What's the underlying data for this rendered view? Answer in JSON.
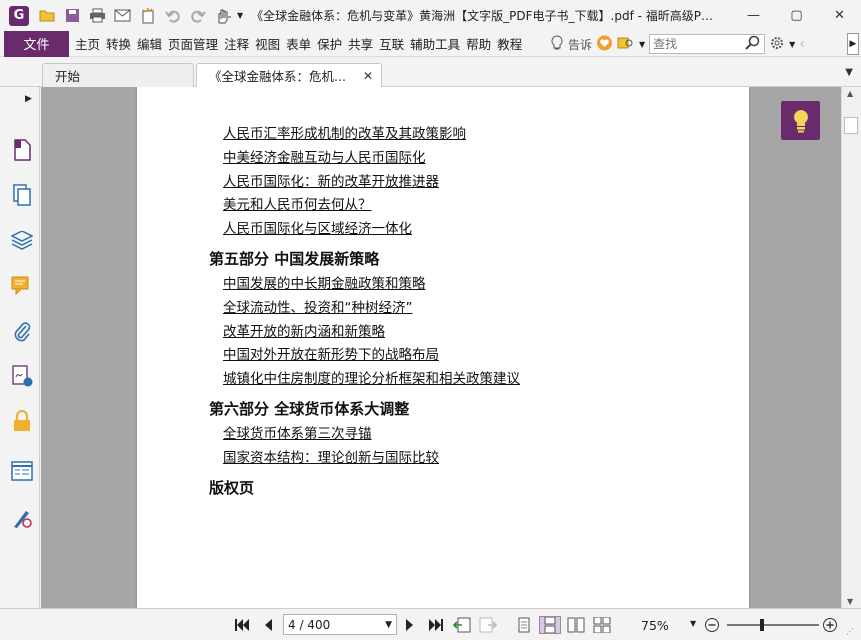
{
  "app": {
    "logo_letter": "G",
    "title": "《全球金融体系：危机与变革》黄海洲【文字版_PDF电子书_下载】.pdf - 福昕高级P…",
    "window_controls": {
      "minimize": "—",
      "restore": "▢",
      "close": "✕"
    }
  },
  "quick_access": [
    "app-menu-icon",
    "open-folder-icon",
    "save-icon",
    "print-icon",
    "email-icon",
    "new-icon",
    "undo-icon",
    "redo-icon",
    "hand-tool-icon"
  ],
  "menubar": {
    "file_label": "文件",
    "items": [
      "主页",
      "转换",
      "编辑",
      "页面管理",
      "注释",
      "视图",
      "表单",
      "保护",
      "共享",
      "互联",
      "辅助工具",
      "帮助",
      "教程"
    ],
    "tell_label": "告诉",
    "search_placeholder": "查找"
  },
  "tabs": [
    {
      "label": "开始",
      "active": false
    },
    {
      "label": "《全球金融体系：危机...",
      "active": true,
      "close": "✕"
    }
  ],
  "document": {
    "entries": [
      {
        "kind": "item",
        "text": "人民币汇率形成机制的改革及其政策影响"
      },
      {
        "kind": "item",
        "text": "中美经济金融互动与人民币国际化"
      },
      {
        "kind": "item",
        "text": "人民币国际化：新的改革开放推进器"
      },
      {
        "kind": "item",
        "text": "美元和人民币何去何从？"
      },
      {
        "kind": "item",
        "text": "人民币国际化与区域经济一体化"
      },
      {
        "kind": "part",
        "text": "第五部分 中国发展新策略"
      },
      {
        "kind": "item",
        "text": "中国发展的中长期金融政策和策略"
      },
      {
        "kind": "item",
        "text": "全球流动性、投资和“种树经济”"
      },
      {
        "kind": "item",
        "text": "改革开放的新内涵和新策略"
      },
      {
        "kind": "item",
        "text": "中国对外开放在新形势下的战略布局"
      },
      {
        "kind": "item",
        "text": "城镇化中住房制度的理论分析框架和相关政策建议"
      },
      {
        "kind": "part",
        "text": "第六部分 全球货币体系大调整"
      },
      {
        "kind": "item",
        "text": "全球货币体系第三次寻锚"
      },
      {
        "kind": "item",
        "text": "国家资本结构：理论创新与国际比较"
      },
      {
        "kind": "part",
        "text": "版权页"
      }
    ]
  },
  "statusbar": {
    "page_display": "4 / 400",
    "zoom": "75%",
    "zoom_level": 0.36
  },
  "colors": {
    "brand": "#6a2b6d",
    "viewport_bg": "#a6a6a6"
  }
}
